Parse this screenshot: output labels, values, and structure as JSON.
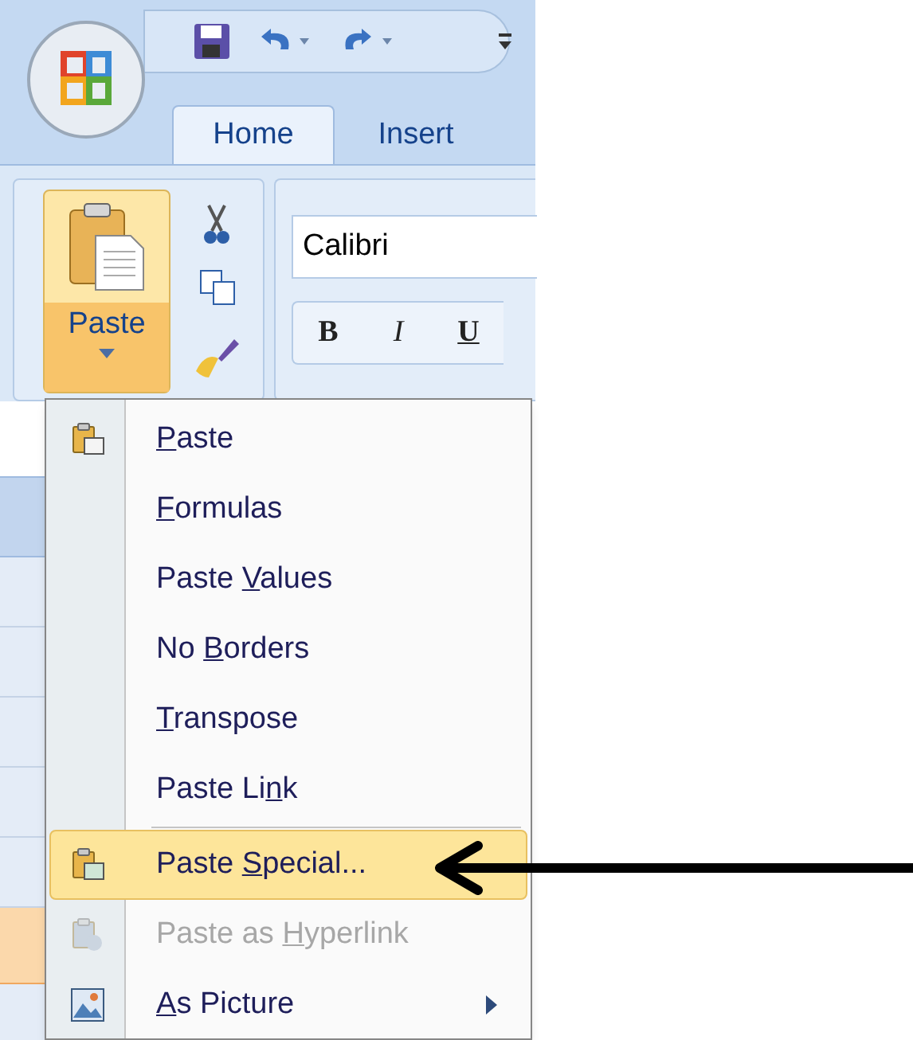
{
  "tabs": [
    {
      "label": "Home",
      "selected": true
    },
    {
      "label": "Insert",
      "selected": false
    }
  ],
  "paste_button": {
    "label": "Paste"
  },
  "font_field": {
    "value": "Calibri"
  },
  "format_buttons": [
    {
      "label": "B",
      "kind": "bold"
    },
    {
      "label": "I",
      "kind": "italic"
    },
    {
      "label": "U",
      "kind": "underline"
    }
  ],
  "menu": [
    {
      "key": "P",
      "after": "aste",
      "kind": "paste",
      "disabled": false,
      "selected": false,
      "submenu": false
    },
    {
      "key": "F",
      "after": "ormulas",
      "disabled": false,
      "selected": false,
      "submenu": false
    },
    {
      "before": "Paste ",
      "key": "V",
      "after": "alues",
      "disabled": false,
      "selected": false,
      "submenu": false
    },
    {
      "before": "No ",
      "key": "B",
      "after": "orders",
      "disabled": false,
      "selected": false,
      "submenu": false
    },
    {
      "key": "T",
      "after": "ranspose",
      "disabled": false,
      "selected": false,
      "submenu": false
    },
    {
      "before": "Paste Li",
      "key": "n",
      "after": "k",
      "disabled": false,
      "selected": false,
      "submenu": false,
      "separator_after": true
    },
    {
      "before": "Paste ",
      "key": "S",
      "after": "pecial...",
      "kind": "special",
      "disabled": false,
      "selected": true,
      "submenu": false
    },
    {
      "before": "Paste as ",
      "key": "H",
      "after": "yperlink",
      "kind": "hyperlink",
      "disabled": true,
      "selected": false,
      "submenu": false
    },
    {
      "key": "A",
      "after": "s Picture",
      "kind": "picture",
      "disabled": false,
      "selected": false,
      "submenu": true
    }
  ]
}
